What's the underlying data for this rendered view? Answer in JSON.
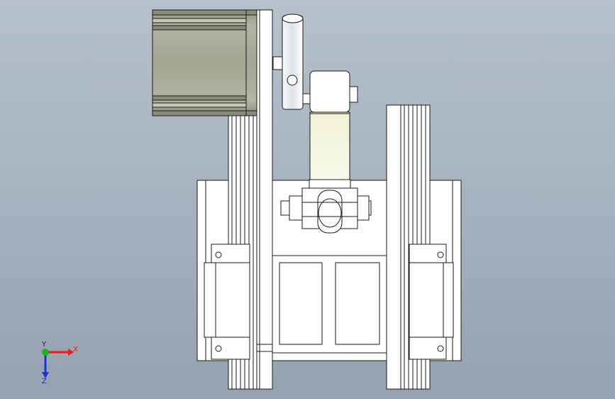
{
  "colors": {
    "background_top": "#b6c1cb",
    "background_bottom": "#94a2b1",
    "part_face": "#ffffff",
    "edge": "#1a1a1a",
    "motor_body": "#a6a898",
    "motor_dark": "#7d7f72",
    "link_face": "#f4f5e0",
    "x_axis": "#e02020",
    "y_axis": "#20b020",
    "z_axis": "#2030d0"
  },
  "triad": {
    "x_label": "X",
    "y_label": "Y",
    "z_label": "Z",
    "icon": "coordinate-triad-icon"
  },
  "drawing": {
    "view": "front",
    "parts": [
      "servo-motor",
      "mounting-plate",
      "crank-arm",
      "connecting-link",
      "clevis-joint",
      "linear-rail-left",
      "linear-rail-right",
      "slide-carriage",
      "sliding-table"
    ]
  }
}
